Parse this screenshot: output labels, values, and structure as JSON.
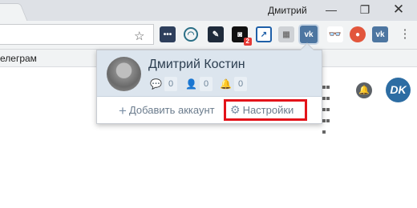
{
  "window": {
    "user_name": "Дмитрий",
    "min_glyph": "—",
    "max_glyph": "❐",
    "close_glyph": "✕"
  },
  "toolbar": {
    "star_icon": "☆",
    "menu_icon": "⋮",
    "extensions": [
      {
        "name": "dots-extension-icon",
        "glyph": "•••"
      },
      {
        "name": "wave-extension-icon",
        "glyph": "◠"
      },
      {
        "name": "tool-extension-icon",
        "glyph": "✎"
      },
      {
        "name": "camera-extension-icon",
        "glyph": "◙",
        "badge": "2"
      },
      {
        "name": "arrow-extension-icon",
        "glyph": "↗"
      },
      {
        "name": "gray-extension-icon",
        "glyph": "▦"
      },
      {
        "name": "vk-extension-icon",
        "glyph": "vk"
      },
      {
        "name": "mask-extension-icon",
        "glyph": "👓"
      },
      {
        "name": "red-circle-extension-icon",
        "glyph": "●"
      },
      {
        "name": "vk2-extension-icon",
        "glyph": "vk"
      }
    ]
  },
  "bookmarks": {
    "item": "елеграм"
  },
  "page": {
    "avatar_initials": "DK"
  },
  "popup": {
    "name": "Дмитрий Костин",
    "stats": [
      {
        "icon": "chat-icon",
        "glyph": "💬",
        "count": "0"
      },
      {
        "icon": "user-icon",
        "glyph": "👤",
        "count": "0"
      },
      {
        "icon": "bell-icon",
        "glyph": "🔔",
        "count": "0"
      }
    ],
    "add_account_plus": "+",
    "add_account": "Добавить аккаунт",
    "settings_gear": "⚙",
    "settings": "Настройки"
  },
  "colors": {
    "highlight": "#e3131a",
    "popup_header": "#dce5ee",
    "vk_blue": "#4d76a1"
  }
}
